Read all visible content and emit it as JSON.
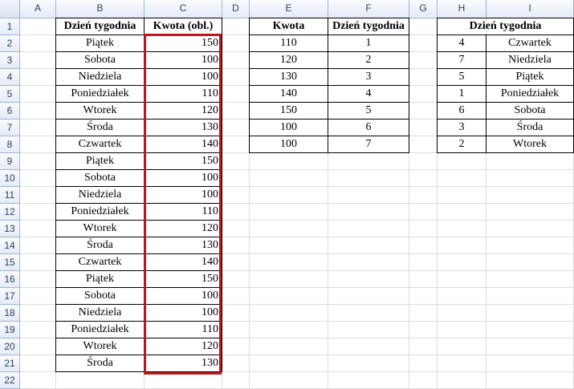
{
  "columns": [
    "A",
    "B",
    "C",
    "D",
    "E",
    "F",
    "G",
    "H",
    "I"
  ],
  "rows": [
    "1",
    "2",
    "3",
    "4",
    "5",
    "6",
    "7",
    "8",
    "9",
    "10",
    "11",
    "12",
    "13",
    "14",
    "15",
    "16",
    "17",
    "18",
    "19",
    "20",
    "21",
    "22"
  ],
  "table_b": {
    "headers": [
      "Dzień tygodnia",
      "Kwota (obl.)"
    ],
    "rows": [
      [
        "Piątek",
        "150"
      ],
      [
        "Sobota",
        "100"
      ],
      [
        "Niedziela",
        "100"
      ],
      [
        "Poniedziałek",
        "110"
      ],
      [
        "Wtorek",
        "120"
      ],
      [
        "Środa",
        "130"
      ],
      [
        "Czwartek",
        "140"
      ],
      [
        "Piątek",
        "150"
      ],
      [
        "Sobota",
        "100"
      ],
      [
        "Niedziela",
        "100"
      ],
      [
        "Poniedziałek",
        "110"
      ],
      [
        "Wtorek",
        "120"
      ],
      [
        "Środa",
        "130"
      ],
      [
        "Czwartek",
        "140"
      ],
      [
        "Piątek",
        "150"
      ],
      [
        "Sobota",
        "100"
      ],
      [
        "Niedziela",
        "100"
      ],
      [
        "Poniedziałek",
        "110"
      ],
      [
        "Wtorek",
        "120"
      ],
      [
        "Środa",
        "130"
      ]
    ]
  },
  "table_e": {
    "headers": [
      "Kwota",
      "Dzień tygodnia"
    ],
    "rows": [
      [
        "110",
        "1"
      ],
      [
        "120",
        "2"
      ],
      [
        "130",
        "3"
      ],
      [
        "140",
        "4"
      ],
      [
        "150",
        "5"
      ],
      [
        "100",
        "6"
      ],
      [
        "100",
        "7"
      ]
    ]
  },
  "table_h": {
    "header": "Dzień tygodnia",
    "rows": [
      [
        "4",
        "Czwartek"
      ],
      [
        "7",
        "Niedziela"
      ],
      [
        "5",
        "Piątek"
      ],
      [
        "1",
        "Poniedziałek"
      ],
      [
        "6",
        "Sobota"
      ],
      [
        "3",
        "Środa"
      ],
      [
        "2",
        "Wtorek"
      ]
    ]
  },
  "colors": {
    "selection_border": "#c0161c",
    "gridline": "#dadcdd",
    "header_text": "#27415f"
  }
}
